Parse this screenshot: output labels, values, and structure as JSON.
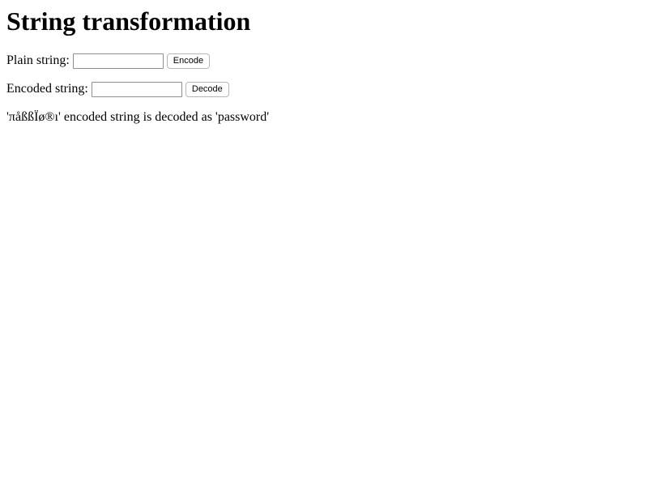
{
  "page": {
    "title": "String transformation"
  },
  "plain": {
    "label": "Plain string:",
    "value": "",
    "placeholder": "",
    "button_label": "Encode"
  },
  "encoded": {
    "label": "Encoded string:",
    "value": "",
    "placeholder": "",
    "button_label": "Decode"
  },
  "result": {
    "text": "'πåßßÏø®ı' encoded string is decoded as 'password'"
  }
}
